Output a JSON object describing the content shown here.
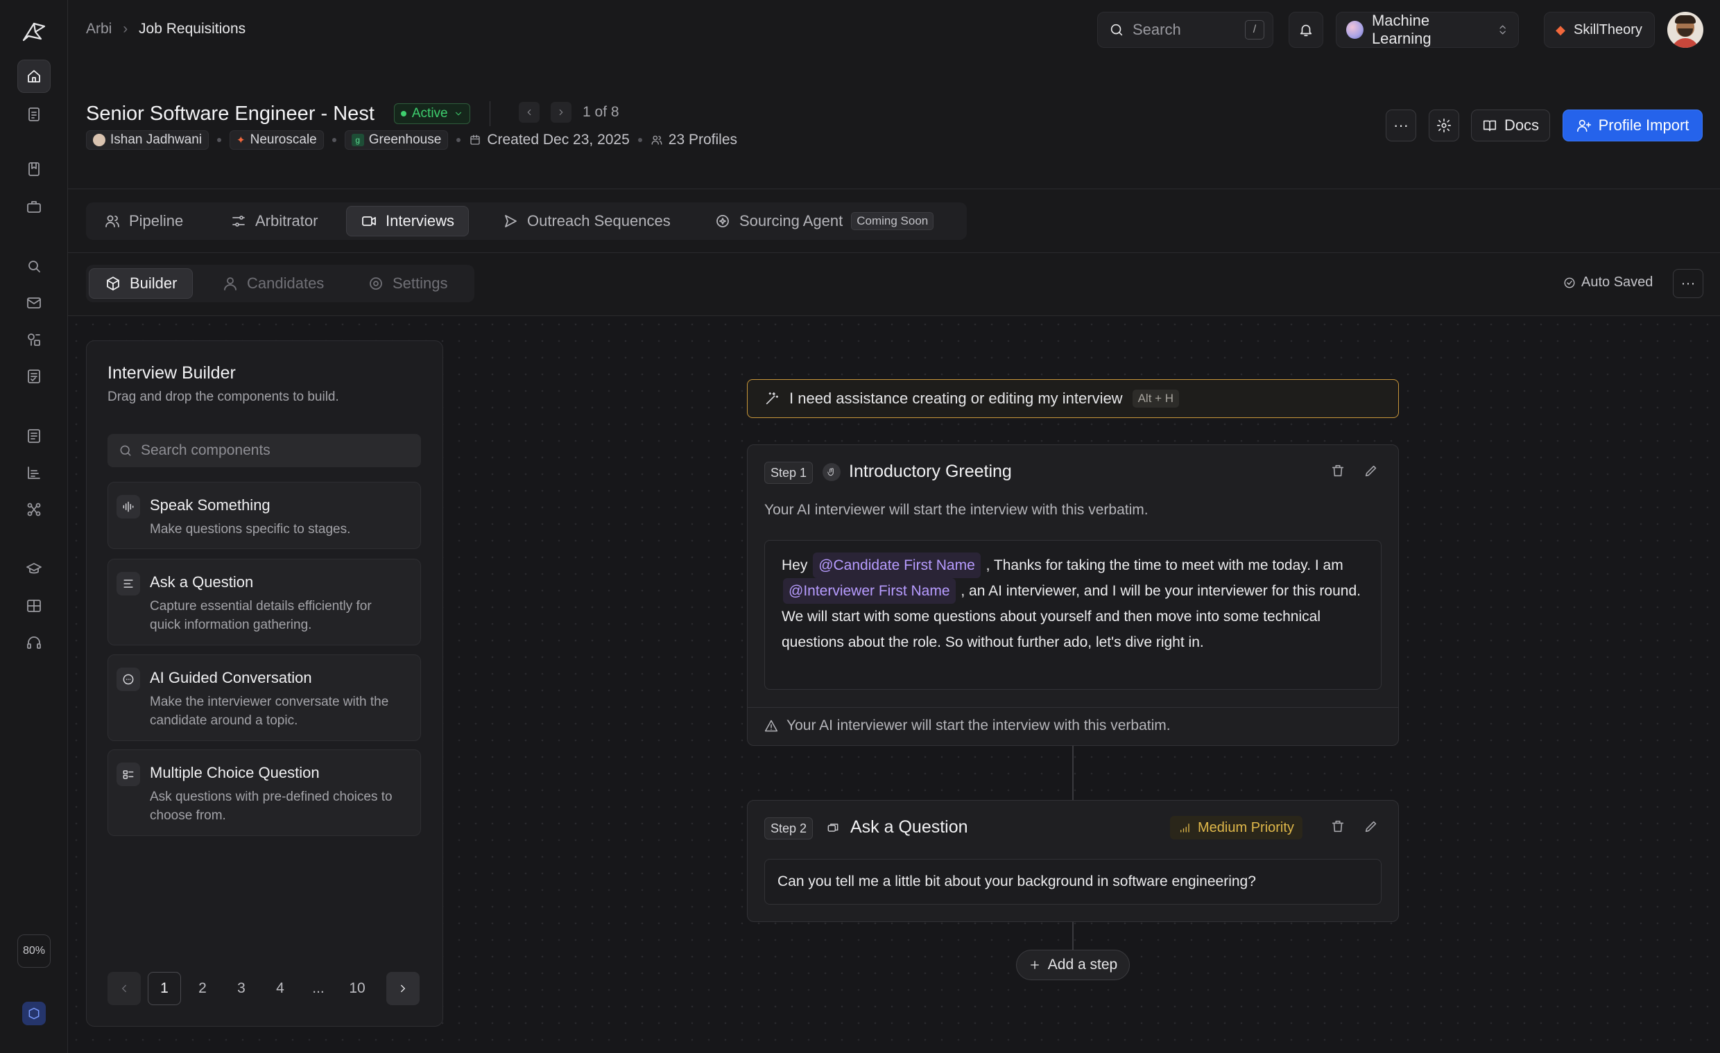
{
  "breadcrumb": {
    "root": "Arbi",
    "current": "Job Requisitions"
  },
  "topbar": {
    "search_placeholder": "Search",
    "search_shortcut": "/",
    "workspace": "Machine Learning",
    "org": "SkillTheory"
  },
  "job": {
    "title": "Senior Software Engineer - Nest",
    "status": "Active",
    "pager": "1 of 8",
    "owner": "Ishan Jadhwani",
    "company": "Neuroscale",
    "ats": "Greenhouse",
    "created": "Created Dec 23, 2025",
    "profiles": "23 Profiles"
  },
  "header_actions": {
    "more": "···",
    "docs": "Docs",
    "profile_import": "Profile Import"
  },
  "tabs": [
    {
      "label": "Pipeline",
      "icon": "users-icon"
    },
    {
      "label": "Arbitrator",
      "icon": "sliders-icon"
    },
    {
      "label": "Interviews",
      "icon": "video-icon"
    },
    {
      "label": "Outreach Sequences",
      "icon": "send-icon"
    },
    {
      "label": "Sourcing Agent",
      "icon": "agent-icon",
      "badge": "Coming Soon"
    }
  ],
  "subtabs": [
    {
      "label": "Builder",
      "icon": "cube-icon"
    },
    {
      "label": "Candidates",
      "icon": "user-icon"
    },
    {
      "label": "Settings",
      "icon": "gear-icon"
    }
  ],
  "autosave": "Auto Saved",
  "builder": {
    "title": "Interview Builder",
    "subtitle": "Drag and drop the components to build.",
    "search_placeholder": "Search components",
    "components": [
      {
        "title": "Speak Something",
        "desc": "Make questions specific to stages.",
        "icon": "waveform-icon"
      },
      {
        "title": "Ask a Question",
        "desc": "Capture essential details efficiently for quick information gathering.",
        "icon": "list-icon"
      },
      {
        "title": "AI Guided Conversation",
        "desc": "Make the interviewer conversate with the candidate around a topic.",
        "icon": "chat-icon"
      },
      {
        "title": "Multiple Choice Question",
        "desc": "Ask questions with pre-defined choices to choose from.",
        "icon": "choice-icon"
      }
    ],
    "pagination": [
      "1",
      "2",
      "3",
      "4",
      "...",
      "10"
    ]
  },
  "assist": {
    "text": "I need assistance creating or editing my interview",
    "shortcut": "Alt + H"
  },
  "steps": [
    {
      "label": "Step 1",
      "title": "Introductory Greeting",
      "description": "Your AI interviewer will start the interview with this verbatim.",
      "verbatim": {
        "p1": "Hey ",
        "m1": "@Candidate First Name",
        "p2": " , Thanks for taking the time to meet with me today. I am ",
        "m2": "@Interviewer First Name",
        "p3": " , an AI interviewer, and I will be your interviewer for this round. We will start with some questions about yourself and then move into some technical questions about the role. So without further ado, let's dive right in."
      },
      "footer": "Your AI interviewer will start the interview with this verbatim."
    },
    {
      "label": "Step 2",
      "title": "Ask a Question",
      "priority": "Medium Priority",
      "question": "Can you tell me a little bit about your background in software engineering?"
    }
  ],
  "add_step": "Add a step",
  "zoom": "80%",
  "colors": {
    "accent": "#2563eb",
    "active_green": "#3ecf6e",
    "priority": "#e0b84a",
    "mention": "#b79cff",
    "assist_border": "#c9973a"
  }
}
